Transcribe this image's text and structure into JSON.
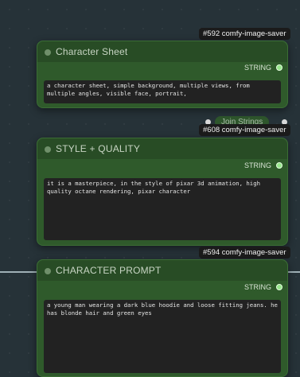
{
  "nodes": [
    {
      "badge": "#592 comfy-image-saver",
      "title": "Character Sheet",
      "output_label": "STRING",
      "text": "a character sheet, simple background, multiple views, from multiple angles, visible face, portrait,"
    },
    {
      "badge": "#608 comfy-image-saver",
      "title": "STYLE + QUALITY",
      "output_label": "STRING",
      "text": "it is a masterpiece, in the style of pixar 3d animation, high quality octane rendering, pixar character"
    },
    {
      "badge": "#594 comfy-image-saver",
      "title": "CHARACTER PROMPT",
      "output_label": "STRING",
      "text": "a young man wearing a dark blue hoodie and loose fitting jeans. he has blonde hair and green eyes"
    }
  ],
  "background_node": {
    "label": "Join Strings"
  },
  "colors": {
    "canvas_bg": "#263238",
    "node_bg": "#2f5a2b",
    "node_header": "#284c25",
    "textbox_bg": "#222222",
    "output_slot": "#98e68d",
    "badge_bg": "#1b1b1b"
  }
}
